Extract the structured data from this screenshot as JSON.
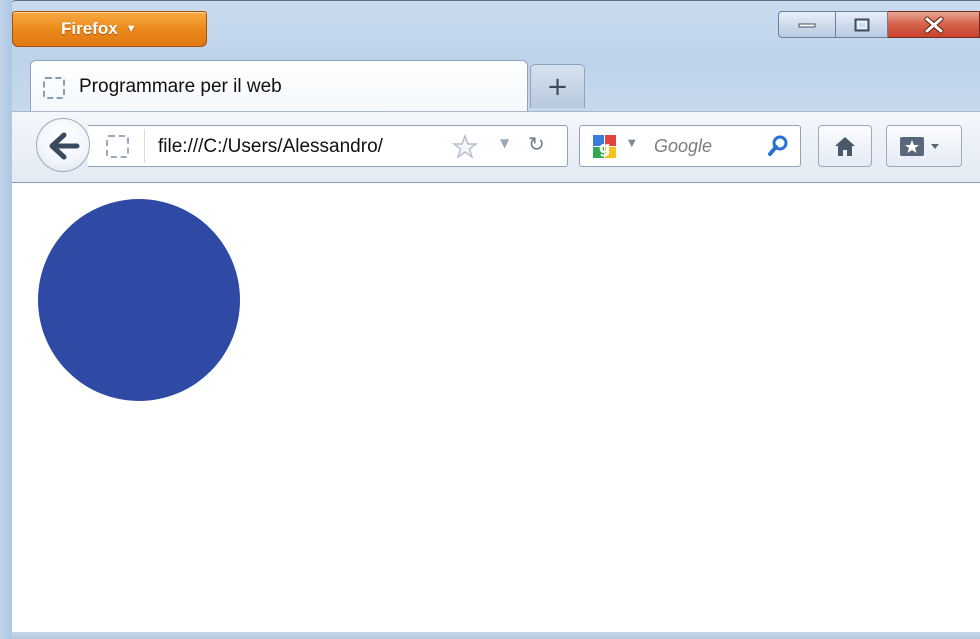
{
  "app": {
    "menu_button_label": "Firefox",
    "menu_button_color": "#eb8a1b"
  },
  "tabs": [
    {
      "title": "Programmare per il web",
      "active": true
    }
  ],
  "new_tab_label": "+",
  "navigation": {
    "url": "file:///C:/Users/Alessandro/",
    "search_engine": "Google",
    "search_placeholder": "Google"
  },
  "page": {
    "shape": "circle",
    "shape_color": "#2e4aa5",
    "background_color": "#ffffff"
  },
  "icons": {
    "back": "back-arrow-icon",
    "site": "site-identity-icon",
    "bookmark_star": "star-icon",
    "history_dropdown": "dropdown-icon",
    "reload": "reload-icon",
    "search_engine": "google-icon",
    "search": "search-icon",
    "home": "home-icon",
    "bookmarks": "bookmarks-icon"
  }
}
